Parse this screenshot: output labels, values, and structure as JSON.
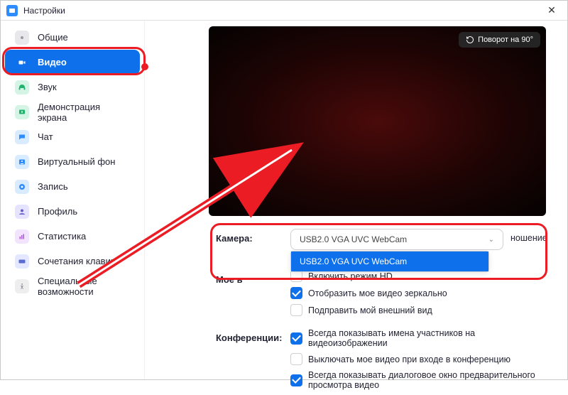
{
  "window": {
    "title": "Настройки"
  },
  "sidebar": {
    "items": [
      {
        "label": "Общие"
      },
      {
        "label": "Видео"
      },
      {
        "label": "Звук"
      },
      {
        "label": "Демонстрация экрана"
      },
      {
        "label": "Чат"
      },
      {
        "label": "Виртуальный фон"
      },
      {
        "label": "Запись"
      },
      {
        "label": "Профиль"
      },
      {
        "label": "Статистика"
      },
      {
        "label": "Сочетания клавиш"
      },
      {
        "label": "Специальные возможности"
      }
    ]
  },
  "preview": {
    "rotate_label": "Поворот на 90°"
  },
  "camera": {
    "label": "Камера:",
    "selected": "USB2.0 VGA UVC WebCam",
    "options": [
      "USB2.0 VGA UVC WebCam"
    ],
    "ratio_suffix": "ношение"
  },
  "my_video": {
    "label": "Мое в",
    "hd": "Включить режим HD",
    "mirror": "Отобразить мое видео зеркально",
    "touchup": "Подправить мой внешний вид"
  },
  "meetings": {
    "label": "Конференции:",
    "show_names": "Всегда показывать имена участников на видеоизображении",
    "mute_video": "Выключать мое видео при входе в конференцию",
    "show_preview": "Всегда показывать диалоговое окно предварительного просмотра видео"
  }
}
